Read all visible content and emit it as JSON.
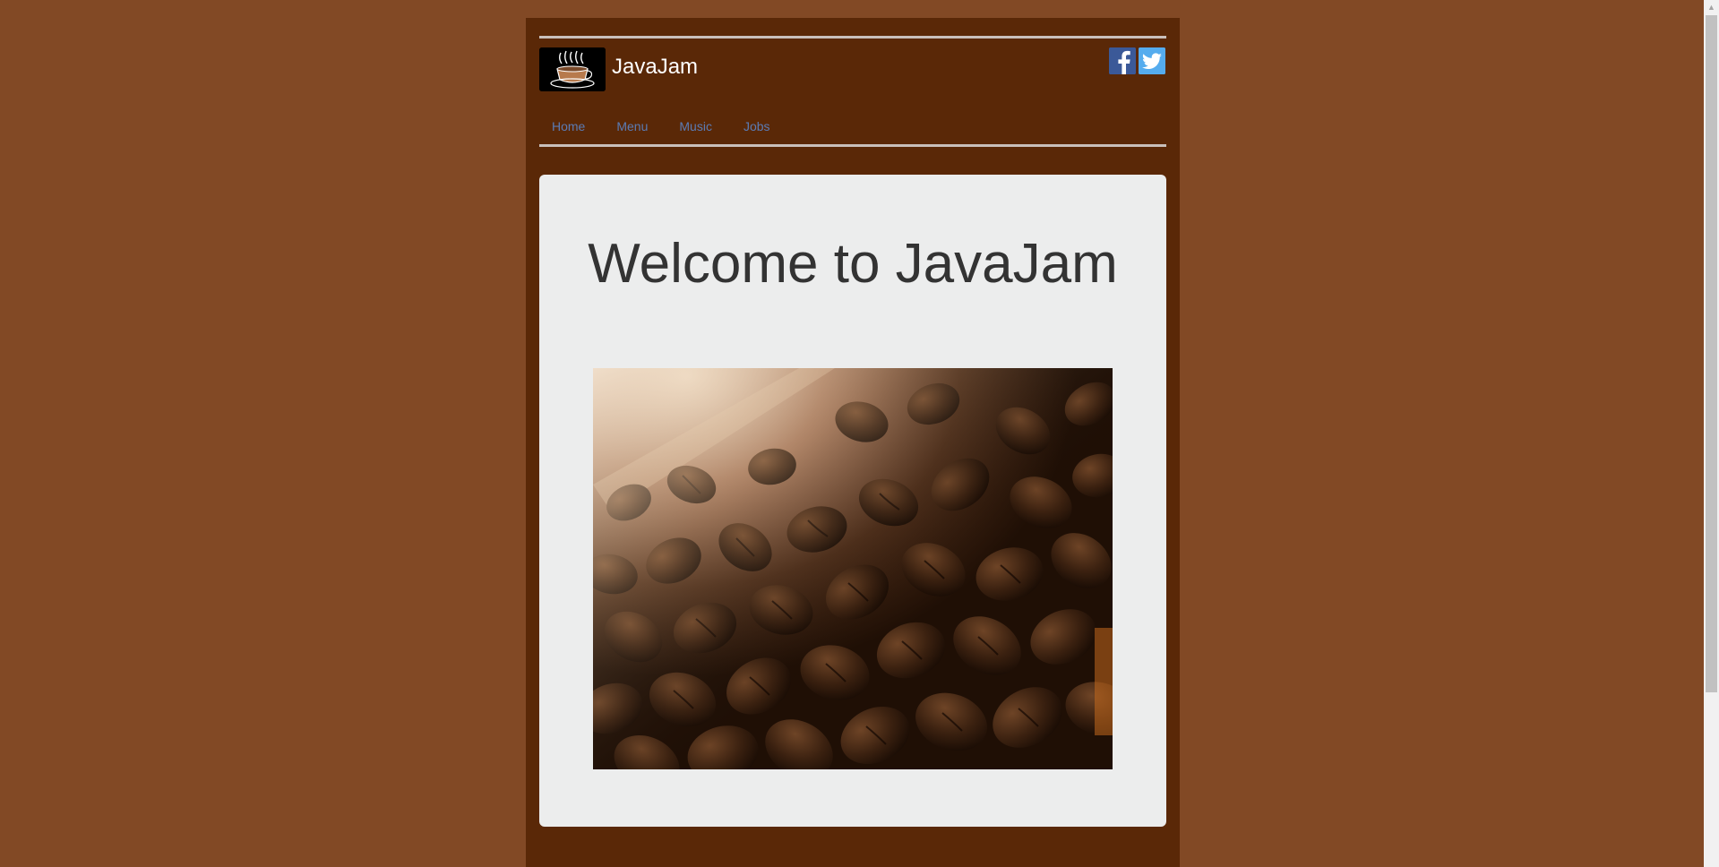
{
  "header": {
    "brand": "JavaJam",
    "logo_icon": "coffee-cup-logo-icon",
    "social": [
      {
        "name": "facebook-icon",
        "color": "#3b5998"
      },
      {
        "name": "twitter-icon",
        "color": "#55acee"
      }
    ]
  },
  "nav": {
    "items": [
      {
        "label": "Home"
      },
      {
        "label": "Menu"
      },
      {
        "label": "Music"
      },
      {
        "label": "Jobs"
      }
    ]
  },
  "main": {
    "headline": "Welcome to JavaJam",
    "hero_image": "coffee-beans-photo"
  },
  "colors": {
    "page_background": "#824925",
    "wrapper_background": "#5a2807",
    "card_background": "#eceded",
    "nav_link": "#5b7bb4",
    "headline": "#333333"
  },
  "scrollbar": {
    "up_icon": "scroll-up-arrow-icon"
  }
}
